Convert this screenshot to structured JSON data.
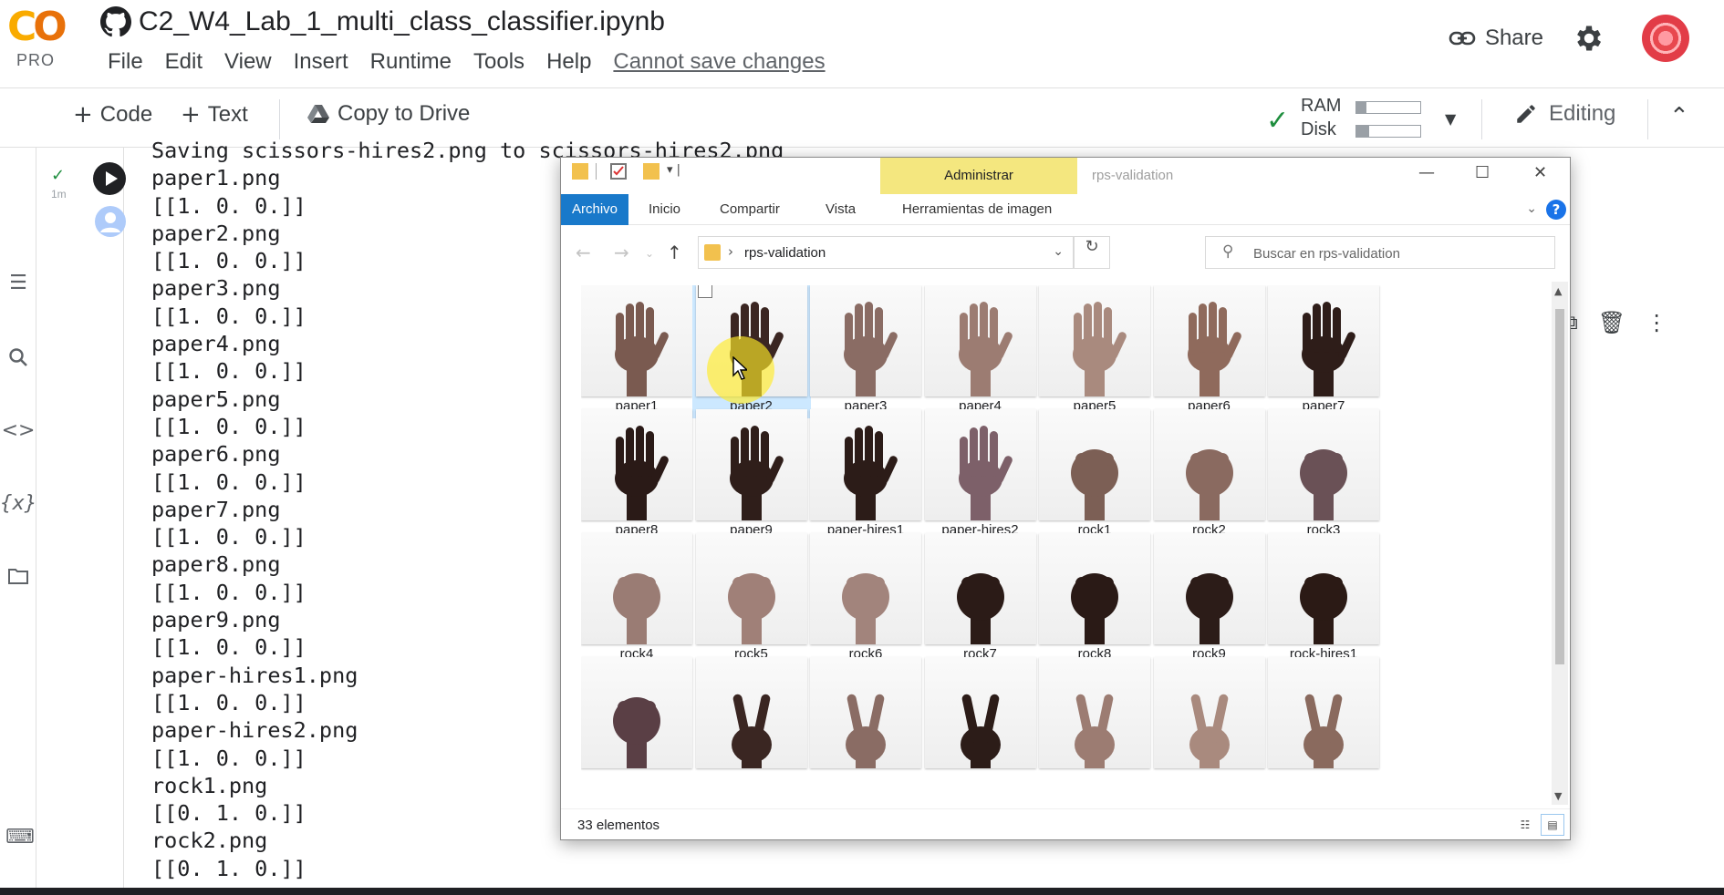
{
  "header": {
    "logo_text": "CO",
    "logo_tier": "PRO",
    "notebook_title": "C2_W4_Lab_1_multi_class_classifier.ipynb",
    "menu": [
      "File",
      "Edit",
      "View",
      "Insert",
      "Runtime",
      "Tools",
      "Help"
    ],
    "save_notice": "Cannot save changes",
    "share_label": "Share"
  },
  "toolbar": {
    "code_label": "Code",
    "text_label": "Text",
    "copy_label": "Copy to Drive",
    "ram_label": "RAM",
    "disk_label": "Disk",
    "ram_usage": 0.15,
    "disk_usage": 0.2,
    "editing_label": "Editing"
  },
  "cell": {
    "exec_time": "1m",
    "output_lines": [
      "Saving scissors-hires2.png to scissors-hires2.png",
      "paper1.png",
      "[[1. 0. 0.]]",
      "paper2.png",
      "[[1. 0. 0.]]",
      "paper3.png",
      "[[1. 0. 0.]]",
      "paper4.png",
      "[[1. 0. 0.]]",
      "paper5.png",
      "[[1. 0. 0.]]",
      "paper6.png",
      "[[1. 0. 0.]]",
      "paper7.png",
      "[[1. 0. 0.]]",
      "paper8.png",
      "[[1. 0. 0.]]",
      "paper9.png",
      "[[1. 0. 0.]]",
      "paper-hires1.png",
      "[[1. 0. 0.]]",
      "paper-hires2.png",
      "[[1. 0. 0.]]",
      "rock1.png",
      "[[0. 1. 0.]]",
      "rock2.png",
      "[[0. 1. 0.]]"
    ]
  },
  "explorer": {
    "context_tab": "Administrar",
    "window_title": "rps-validation",
    "ribbon_tabs": [
      "Archivo",
      "Inicio",
      "Compartir",
      "Vista",
      "Herramientas de imagen"
    ],
    "address_path": "rps-validation",
    "search_placeholder": "Buscar en rps-validation",
    "item_count": "33 elementos",
    "selected_item": "paper2",
    "files": [
      {
        "name": "paper1",
        "gesture": "paper",
        "skin": "#7a5a50"
      },
      {
        "name": "paper2",
        "gesture": "paper",
        "skin": "#3b2622"
      },
      {
        "name": "paper3",
        "gesture": "paper",
        "skin": "#8a6c64"
      },
      {
        "name": "paper4",
        "gesture": "paper",
        "skin": "#9c7c72"
      },
      {
        "name": "paper5",
        "gesture": "paper",
        "skin": "#a98a7e"
      },
      {
        "name": "paper6",
        "gesture": "paper",
        "skin": "#8f6a5c"
      },
      {
        "name": "paper7",
        "gesture": "paper",
        "skin": "#2e1d19"
      },
      {
        "name": "paper8",
        "gesture": "paper",
        "skin": "#2a1a17"
      },
      {
        "name": "paper9",
        "gesture": "paper",
        "skin": "#2f1e1a"
      },
      {
        "name": "paper-hires1",
        "gesture": "paper",
        "skin": "#2c1c18"
      },
      {
        "name": "paper-hires2",
        "gesture": "paper",
        "skin": "#7d6069"
      },
      {
        "name": "rock1",
        "gesture": "rock",
        "skin": "#7c5f55"
      },
      {
        "name": "rock2",
        "gesture": "rock",
        "skin": "#8a6a60"
      },
      {
        "name": "rock3",
        "gesture": "rock",
        "skin": "#6a5156"
      },
      {
        "name": "rock4",
        "gesture": "rock",
        "skin": "#9a7c74"
      },
      {
        "name": "rock5",
        "gesture": "rock",
        "skin": "#a08078"
      },
      {
        "name": "rock6",
        "gesture": "rock",
        "skin": "#a2847c"
      },
      {
        "name": "rock7",
        "gesture": "rock",
        "skin": "#2b1b17"
      },
      {
        "name": "rock8",
        "gesture": "rock",
        "skin": "#2a1a16"
      },
      {
        "name": "rock9",
        "gesture": "rock",
        "skin": "#2c1c18"
      },
      {
        "name": "rock-hires1",
        "gesture": "rock",
        "skin": "#2b1a15"
      },
      {
        "name": "",
        "gesture": "rock",
        "skin": "#5a3f45"
      },
      {
        "name": "",
        "gesture": "scissors",
        "skin": "#3a2622"
      },
      {
        "name": "",
        "gesture": "scissors",
        "skin": "#8a6c64"
      },
      {
        "name": "",
        "gesture": "scissors",
        "skin": "#2c1c18"
      },
      {
        "name": "",
        "gesture": "scissors",
        "skin": "#9c7c72"
      },
      {
        "name": "",
        "gesture": "scissors",
        "skin": "#a98a7e"
      },
      {
        "name": "",
        "gesture": "scissors",
        "skin": "#8a6a5e"
      }
    ]
  },
  "colors": {
    "accent_blue": "#1979ca",
    "admin_yellow": "#f4e77f",
    "run_ok_green": "#1e8e3e",
    "logo_orange": "#f9ab00"
  }
}
